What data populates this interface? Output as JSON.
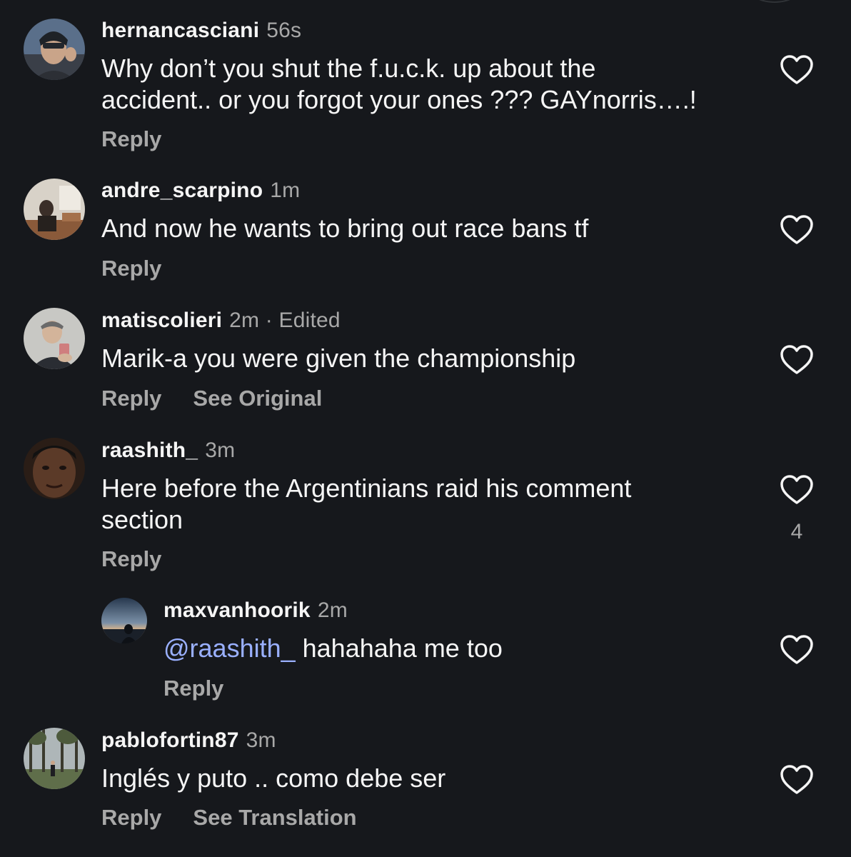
{
  "comments": [
    {
      "username": "hernancasciani",
      "time": "56s",
      "text_line1": "Why don’t you shut the f.u.c.k. up about the",
      "text_line2": "accident.. or you forgot your ones ??? GAYnorris….!",
      "reply_label": "Reply",
      "avatar_icon": "user-photo"
    },
    {
      "username": "andre_scarpino",
      "time": "1m",
      "text": "And now he wants to bring out race bans tf",
      "reply_label": "Reply",
      "avatar_icon": "user-photo"
    },
    {
      "username": "matiscolieri",
      "time": "2m",
      "edited": " · Edited",
      "text": "Marik-a you were given the championship",
      "reply_label": "Reply",
      "secondary_action": "See Original",
      "avatar_icon": "user-photo"
    },
    {
      "username": "raashith_",
      "time": "3m",
      "text_line1": "Here before the Argentinians raid his comment",
      "text_line2": "section",
      "reply_label": "Reply",
      "like_count": "4",
      "avatar_icon": "user-photo"
    },
    {
      "username": "maxvanhoorik",
      "time": "2m",
      "mention": "@raashith_",
      "text": " hahahaha me too",
      "reply_label": "Reply",
      "avatar_icon": "user-photo"
    },
    {
      "username": "pablofortin87",
      "time": "3m",
      "text": "Inglés y puto .. como debe ser",
      "reply_label": "Reply",
      "secondary_action": "See Translation",
      "avatar_icon": "user-photo"
    }
  ],
  "icons": {
    "like": "heart-outline-icon"
  },
  "colors": {
    "background": "#16181c",
    "primary_text": "#f5f5f5",
    "secondary_text": "#a8a8a8",
    "mention": "#9ab0ff"
  }
}
